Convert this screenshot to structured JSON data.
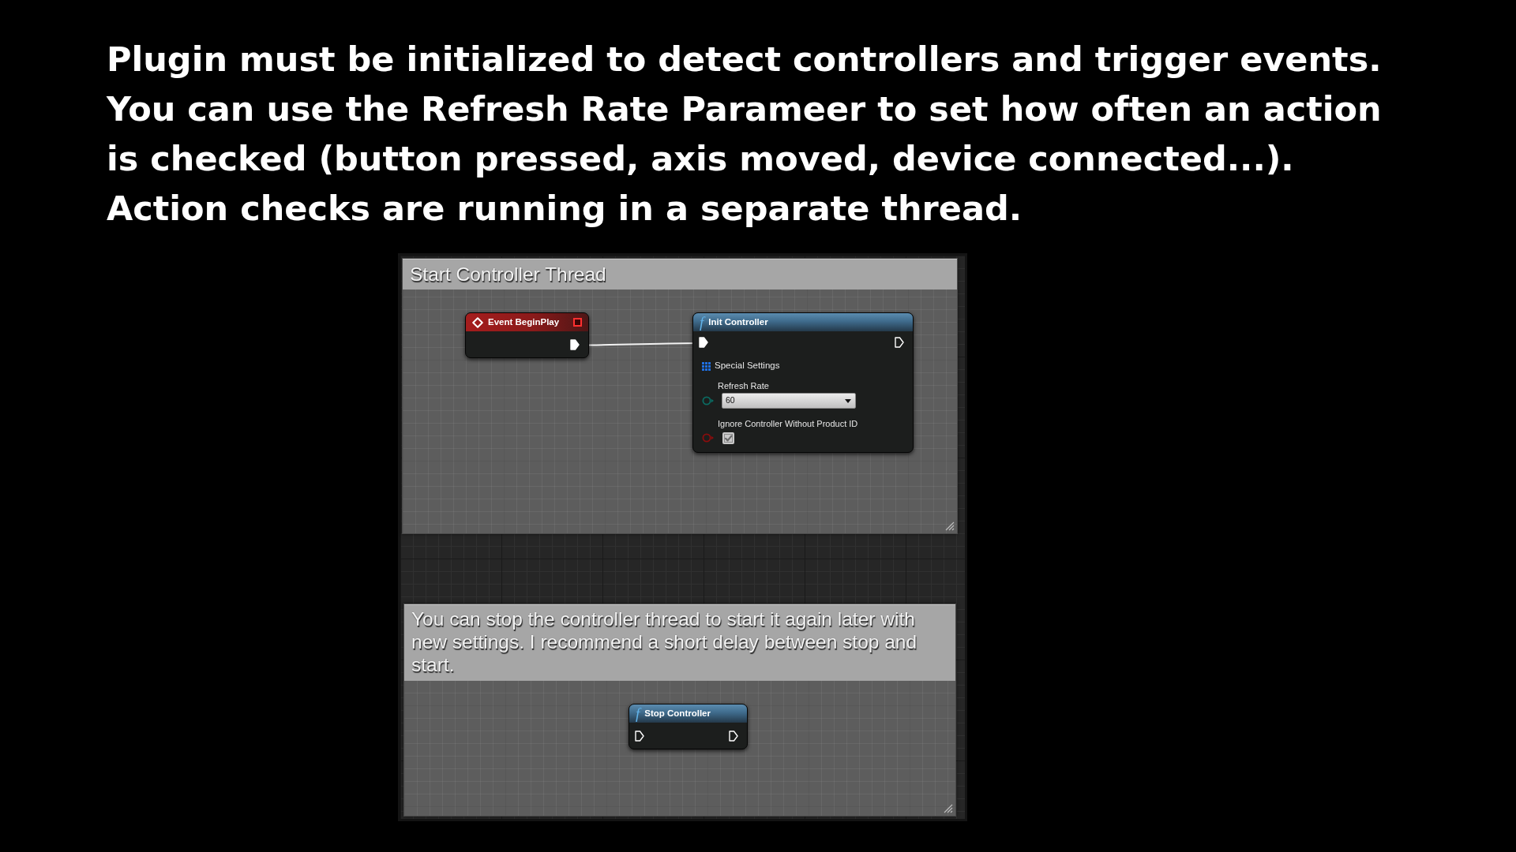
{
  "intro": {
    "lines": [
      "Plugin must be initialized to detect controllers and trigger events.",
      "You can use the Refresh Rate Parameer to set how often an action",
      "is checked (button pressed, axis moved, device connected...).",
      "Action checks are running in a separate thread."
    ]
  },
  "graph": {
    "comments": [
      {
        "title": "Start Controller Thread",
        "nodes": [
          {
            "kind": "event",
            "title": "Event BeginPlay",
            "exec_out": {
              "connected": true
            }
          },
          {
            "kind": "function",
            "icon": "f",
            "title": "Init Controller",
            "exec_in": {
              "connected": true
            },
            "exec_out": {
              "connected": false
            },
            "params": [
              {
                "kind": "category",
                "label": "Special Settings"
              },
              {
                "kind": "dropdown",
                "label": "Refresh Rate",
                "value": "60",
                "color": "#0b6b62"
              },
              {
                "kind": "checkbox",
                "label": "Ignore Controller Without Product ID",
                "checked": true,
                "color": "#8a0d0d"
              }
            ]
          }
        ]
      },
      {
        "title": "You can stop the controller thread to start it again later with new settings. I recommend a short delay between stop and start.",
        "nodes": [
          {
            "kind": "function",
            "icon": "f",
            "title": "Stop Controller",
            "exec_in": {
              "connected": false
            },
            "exec_out": {
              "connected": false
            }
          }
        ]
      }
    ]
  }
}
